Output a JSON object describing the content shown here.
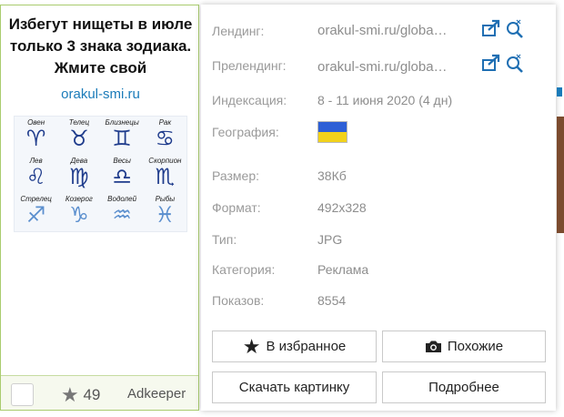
{
  "card": {
    "title": "Избегут нищеты в июле только 3 знака зодиака. Жмите свой",
    "domain": "orakul-smi.ru",
    "zodiac": [
      {
        "name": "Овен",
        "glyph": "♈",
        "tone": "dark"
      },
      {
        "name": "Телец",
        "glyph": "♉",
        "tone": "dark"
      },
      {
        "name": "Близнецы",
        "glyph": "♊",
        "tone": "dark"
      },
      {
        "name": "Рак",
        "glyph": "♋",
        "tone": "dark"
      },
      {
        "name": "Лев",
        "glyph": "♌",
        "tone": "dark"
      },
      {
        "name": "Дева",
        "glyph": "♍",
        "tone": "dark"
      },
      {
        "name": "Весы",
        "glyph": "♎",
        "tone": "dark"
      },
      {
        "name": "Скорпион",
        "glyph": "♏",
        "tone": "dark"
      },
      {
        "name": "Стрелец",
        "glyph": "♐",
        "tone": "light"
      },
      {
        "name": "Козерог",
        "glyph": "♑",
        "tone": "light"
      },
      {
        "name": "Водолей",
        "glyph": "♒",
        "tone": "light"
      },
      {
        "name": "Рыбы",
        "glyph": "♓",
        "tone": "light"
      }
    ],
    "star_count": "49",
    "network": "Adkeeper"
  },
  "details": {
    "landing_label": "Лендинг:",
    "landing_value": "orakul-smi.ru/globa…",
    "prelanding_label": "Прелендинг:",
    "prelanding_value": "orakul-smi.ru/globa…",
    "indexing_label": "Индексация:",
    "indexing_value": "8 - 11 июня 2020 (4 дн)",
    "geo_label": "География:",
    "size_label": "Размер:",
    "size_value": "38Кб",
    "format_label": "Формат:",
    "format_value": "492x328",
    "type_label": "Тип:",
    "type_value": "JPG",
    "category_label": "Категория:",
    "category_value": "Реклама",
    "shows_label": "Показов:",
    "shows_value": "8554"
  },
  "buttons": {
    "favorite": "В избранное",
    "similar": "Похожие",
    "download": "Скачать картинку",
    "more": "Подробнее"
  },
  "colors": {
    "card_border": "#a9cc6e",
    "link": "#1a7bb9",
    "flag_blue": "#2d5fd6",
    "flag_yellow": "#f2d21b"
  }
}
